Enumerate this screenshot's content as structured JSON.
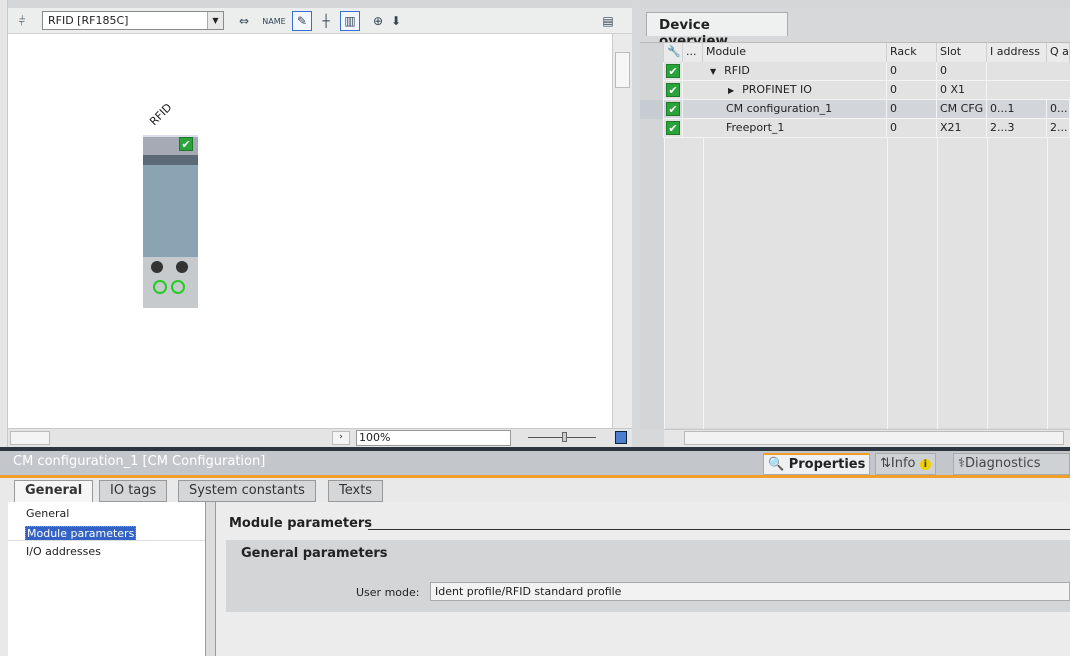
{
  "toolbar": {
    "device_select": "RFID [RF185C]",
    "zoom": "100%"
  },
  "device": {
    "label": "RFID"
  },
  "overview": {
    "tab": "Device overview",
    "headers": [
      "...",
      "Module",
      "Rack",
      "Slot",
      "I address",
      "Q a"
    ],
    "rows": [
      {
        "module": "RFID",
        "rack": "0",
        "slot": "0",
        "i": "",
        "q": "",
        "expander": "▼"
      },
      {
        "module": "PROFINET IO",
        "rack": "0",
        "slot": "0 X1",
        "i": "",
        "q": "",
        "expander": "▶"
      },
      {
        "module": "CM configuration_1",
        "rack": "0",
        "slot": "CM CFG",
        "i": "0...1",
        "q": "0..."
      },
      {
        "module": "Freeport_1",
        "rack": "0",
        "slot": "X21",
        "i": "2...3",
        "q": "2..."
      }
    ]
  },
  "inspector": {
    "title": "CM configuration_1 [CM Configuration]",
    "tabs": [
      "Properties",
      "Info",
      "Diagnostics"
    ],
    "subtabs": [
      "General",
      "IO tags",
      "System constants",
      "Texts"
    ],
    "nav": [
      "General",
      "Module parameters",
      "I/O addresses"
    ],
    "section": "Module parameters",
    "group": "General parameters",
    "user_mode_label": "User mode:",
    "user_mode_value": "Ident profile/RFID standard profile"
  }
}
